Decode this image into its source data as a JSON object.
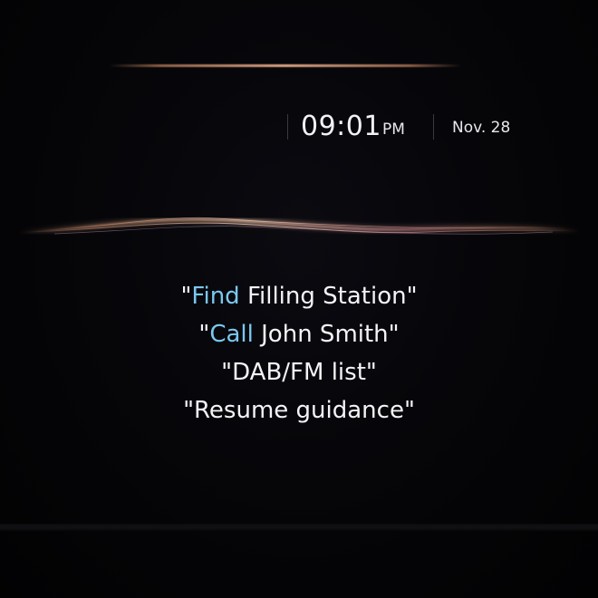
{
  "status": {
    "time": "09:01",
    "ampm": "PM",
    "date": "Nov. 28"
  },
  "voice_commands": [
    {
      "quote_open": "\"",
      "keyword": "Find",
      "rest": " Filling Station",
      "quote_close": "\""
    },
    {
      "quote_open": "\"",
      "keyword": "Call",
      "rest": " John Smith",
      "quote_close": "\""
    },
    {
      "text": "\"DAB/FM list\""
    },
    {
      "text": "\"Resume guidance\""
    }
  ],
  "colors": {
    "background": "#050508",
    "text": "#f4f4f7",
    "keyword_accent": "#7ac8ef",
    "wave_glow": "#ffb48c"
  },
  "icons": {
    "voice_wave": "voice-waveform-icon"
  }
}
